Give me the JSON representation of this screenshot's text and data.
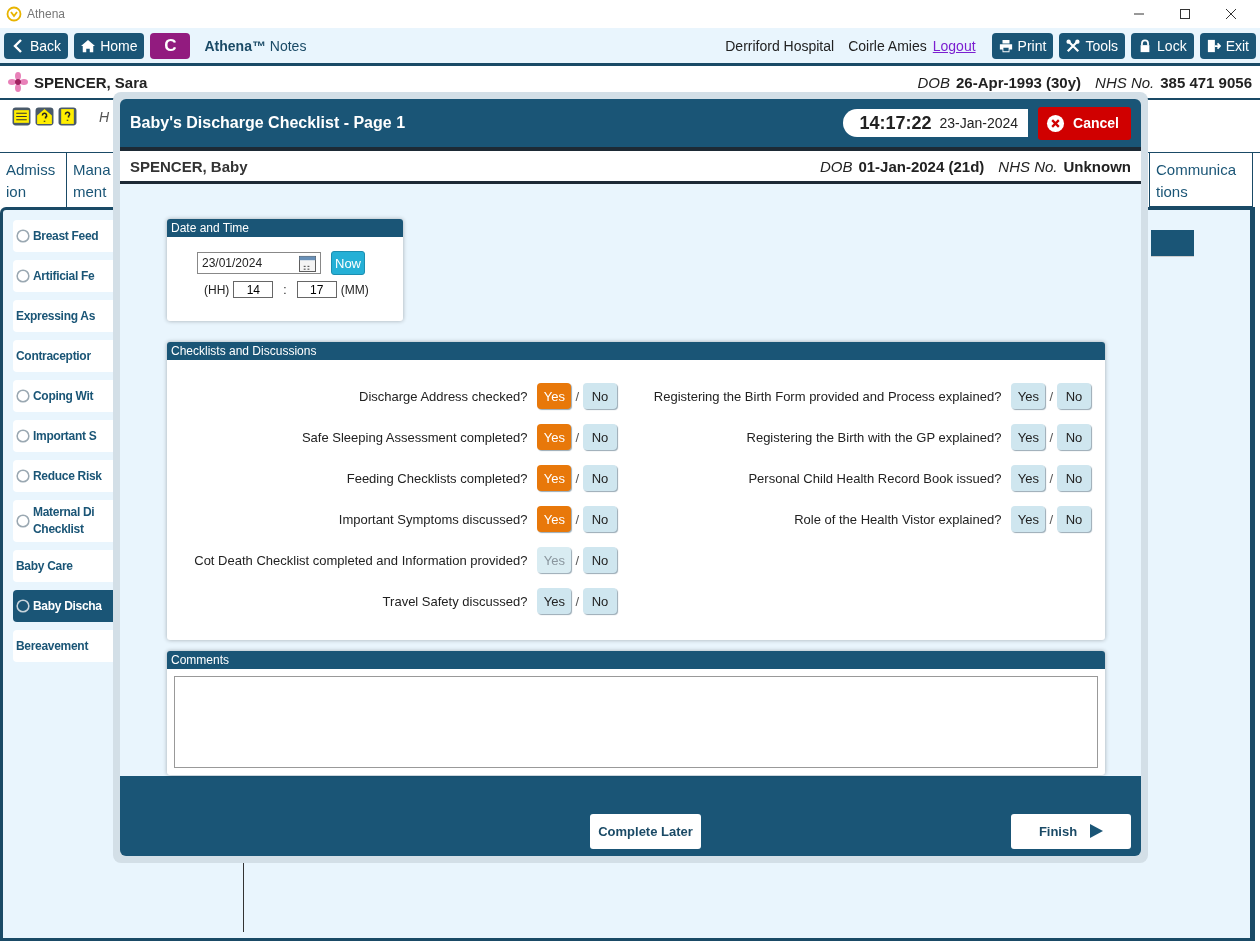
{
  "window": {
    "title": "Athena"
  },
  "toolbar": {
    "buttons": [
      {
        "label": "Back"
      },
      {
        "label": "Home"
      }
    ],
    "badge": "C",
    "app_name": "Athena™",
    "app_suffix": "Notes",
    "hospital": "Derriford Hospital",
    "user": "Coirle Amies",
    "logout": "Logout",
    "actions": [
      {
        "label": "Print"
      },
      {
        "label": "Tools"
      },
      {
        "label": "Lock"
      },
      {
        "label": "Exit"
      }
    ]
  },
  "patient": {
    "name": "SPENCER, Sara",
    "dob_label": "DOB",
    "dob": "26-Apr-1993 (30y)",
    "nhs_label": "NHS No.",
    "nhs": "385 471 9056"
  },
  "info_text": "H",
  "tabs": [
    {
      "lines": [
        "Admiss",
        "ion"
      ],
      "selected": false
    },
    {
      "lines": [
        "Mana",
        "ment"
      ],
      "selected": false
    },
    {
      "lines": [
        "Communica",
        "tions"
      ],
      "selected": false
    }
  ],
  "sidebar": {
    "items": [
      {
        "label": "Breast Feed",
        "radio": true,
        "selected": false
      },
      {
        "label": "Artificial Fe",
        "radio": true,
        "selected": false
      },
      {
        "label": "Expressing As",
        "radio": false,
        "selected": false
      },
      {
        "label": "Contraceptior",
        "radio": false,
        "selected": false
      },
      {
        "label": "Coping Wit",
        "radio": true,
        "selected": false
      },
      {
        "label": "Important S",
        "radio": true,
        "selected": false
      },
      {
        "label": "Reduce Risk",
        "radio": true,
        "selected": false
      },
      {
        "label": "Maternal Di\nChecklist",
        "radio": true,
        "selected": false
      },
      {
        "label": "Baby Care",
        "radio": false,
        "selected": false
      },
      {
        "label": "Baby Discha",
        "radio": true,
        "selected": true
      },
      {
        "label": "Bereavement",
        "radio": false,
        "selected": false
      }
    ]
  },
  "dialog": {
    "title": "Baby's Discharge Checklist - Page 1",
    "clock_time": "14:17:22",
    "clock_date": "23-Jan-2024",
    "cancel": "Cancel",
    "baby": {
      "name": "SPENCER, Baby",
      "dob_label": "DOB",
      "dob": "01-Jan-2024 (21d)",
      "nhs_label": "NHS No.",
      "nhs": "Unknown"
    },
    "date_time": {
      "title": "Date and Time",
      "date": "23/01/2024",
      "now": "Now",
      "hh_label": "(HH)",
      "hh": "14",
      "colon": ":",
      "mm": "17",
      "mm_label": "(MM)"
    },
    "checklists": {
      "title": "Checklists and Discussions",
      "columns": [
        [
          {
            "label": "Discharge Address checked?",
            "separator": "/",
            "options": [
              {
                "label": "Yes",
                "selected": true,
                "disabled": false
              },
              {
                "label": "No",
                "selected": false,
                "disabled": false
              }
            ]
          },
          {
            "label": "Safe Sleeping Assessment completed?",
            "separator": "/",
            "options": [
              {
                "label": "Yes",
                "selected": true,
                "disabled": false
              },
              {
                "label": "No",
                "selected": false,
                "disabled": false
              }
            ]
          },
          {
            "label": "Feeding Checklists completed?",
            "separator": "/",
            "options": [
              {
                "label": "Yes",
                "selected": true,
                "disabled": false
              },
              {
                "label": "No",
                "selected": false,
                "disabled": false
              }
            ]
          },
          {
            "label": "Important Symptoms discussed?",
            "separator": "/",
            "options": [
              {
                "label": "Yes",
                "selected": true,
                "disabled": false
              },
              {
                "label": "No",
                "selected": false,
                "disabled": false
              }
            ]
          },
          {
            "label": "Cot Death Checklist completed and Information provided?",
            "separator": "/",
            "options": [
              {
                "label": "Yes",
                "selected": false,
                "disabled": true
              },
              {
                "label": "No",
                "selected": false,
                "disabled": false
              }
            ]
          },
          {
            "label": "Travel Safety discussed?",
            "separator": "/",
            "options": [
              {
                "label": "Yes",
                "selected": false,
                "disabled": false
              },
              {
                "label": "No",
                "selected": false,
                "disabled": false
              }
            ]
          }
        ],
        [
          {
            "label": "Registering the Birth Form provided and Process explained?",
            "separator": "/",
            "options": [
              {
                "label": "Yes",
                "selected": false,
                "disabled": false
              },
              {
                "label": "No",
                "selected": false,
                "disabled": false
              }
            ]
          },
          {
            "label": "Registering the Birth with the GP explained?",
            "separator": "/",
            "options": [
              {
                "label": "Yes",
                "selected": false,
                "disabled": false
              },
              {
                "label": "No",
                "selected": false,
                "disabled": false
              }
            ]
          },
          {
            "label": "Personal Child Health Record Book issued?",
            "separator": "/",
            "options": [
              {
                "label": "Yes",
                "selected": false,
                "disabled": false
              },
              {
                "label": "No",
                "selected": false,
                "disabled": false
              }
            ]
          },
          {
            "label": "Role of the Health Vistor explained?",
            "separator": "/",
            "options": [
              {
                "label": "Yes",
                "selected": false,
                "disabled": false
              },
              {
                "label": "No",
                "selected": false,
                "disabled": false
              }
            ]
          }
        ]
      ]
    },
    "comments": {
      "title": "Comments"
    },
    "footer": {
      "complete_later": "Complete Later",
      "finish": "Finish"
    }
  }
}
